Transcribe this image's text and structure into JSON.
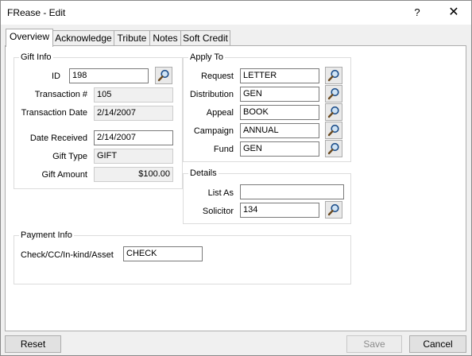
{
  "window": {
    "title": "FRease - Edit",
    "help_glyph": "?",
    "close_glyph": "✕"
  },
  "tabs": [
    {
      "label": "Overview",
      "active": true
    },
    {
      "label": "Acknowledge",
      "active": false
    },
    {
      "label": "Tribute",
      "active": false
    },
    {
      "label": "Notes",
      "active": false
    },
    {
      "label": "Soft Credit",
      "active": false
    }
  ],
  "gift_info": {
    "group_label": "Gift Info",
    "id": {
      "label": "ID",
      "value": "198"
    },
    "transaction_number": {
      "label": "Transaction #",
      "value": "105"
    },
    "transaction_date": {
      "label": "Transaction Date",
      "value": "2/14/2007"
    },
    "date_received": {
      "label": "Date Received",
      "value": "2/14/2007"
    },
    "gift_type": {
      "label": "Gift Type",
      "value": "GIFT"
    },
    "gift_amount": {
      "label": "Gift Amount",
      "value": "$100.00"
    }
  },
  "apply_to": {
    "group_label": "Apply To",
    "request": {
      "label": "Request",
      "value": "LETTER"
    },
    "distribution": {
      "label": "Distribution",
      "value": "GEN"
    },
    "appeal": {
      "label": "Appeal",
      "value": "BOOK"
    },
    "campaign": {
      "label": "Campaign",
      "value": "ANNUAL"
    },
    "fund": {
      "label": "Fund",
      "value": "GEN"
    }
  },
  "details": {
    "group_label": "Details",
    "list_as": {
      "label": "List As",
      "value": ""
    },
    "solicitor": {
      "label": "Solicitor",
      "value": "134"
    }
  },
  "payment_info": {
    "group_label": "Payment Info",
    "check": {
      "label": "Check/CC/In-kind/Asset",
      "value": "CHECK"
    }
  },
  "buttons": {
    "reset": "Reset",
    "save": "Save",
    "cancel": "Cancel"
  },
  "icons": {
    "lookup": "magnifier-icon"
  }
}
